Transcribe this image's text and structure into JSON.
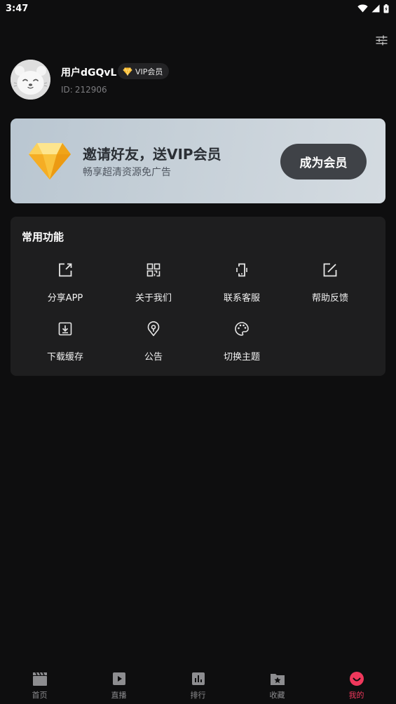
{
  "status_bar": {
    "time": "3:47",
    "icons": [
      "wifi-icon",
      "cell-signal-icon",
      "battery-icon"
    ]
  },
  "header": {
    "settings_icon": "sliders-icon"
  },
  "profile": {
    "username": "用户dGQvL",
    "vip_badge": "VIP会员",
    "id_label": "ID:",
    "id_value": "212906"
  },
  "banner": {
    "title": "邀请好友，送VIP会员",
    "subtitle": "畅享超清资源免广告",
    "cta": "成为会员"
  },
  "functions": {
    "title": "常用功能",
    "items": [
      {
        "label": "分享APP",
        "icon": "share-icon"
      },
      {
        "label": "关于我们",
        "icon": "qrcode-icon"
      },
      {
        "label": "联系客服",
        "icon": "phone-icon"
      },
      {
        "label": "帮助反馈",
        "icon": "edit-icon"
      },
      {
        "label": "下载缓存",
        "icon": "download-icon"
      },
      {
        "label": "公告",
        "icon": "announcement-icon"
      },
      {
        "label": "切换主题",
        "icon": "palette-icon"
      }
    ]
  },
  "bottom_nav": {
    "active": "我的",
    "items": [
      {
        "label": "首页",
        "icon": "clapperboard-icon"
      },
      {
        "label": "直播",
        "icon": "play-icon"
      },
      {
        "label": "排行",
        "icon": "bar-chart-icon"
      },
      {
        "label": "收藏",
        "icon": "star-folder-icon"
      },
      {
        "label": "我的",
        "icon": "smile-icon"
      }
    ]
  },
  "colors": {
    "background": "#0e0e0f",
    "card": "#1e1e1f",
    "accent": "#f0385c",
    "gem": "#f7b82a"
  }
}
